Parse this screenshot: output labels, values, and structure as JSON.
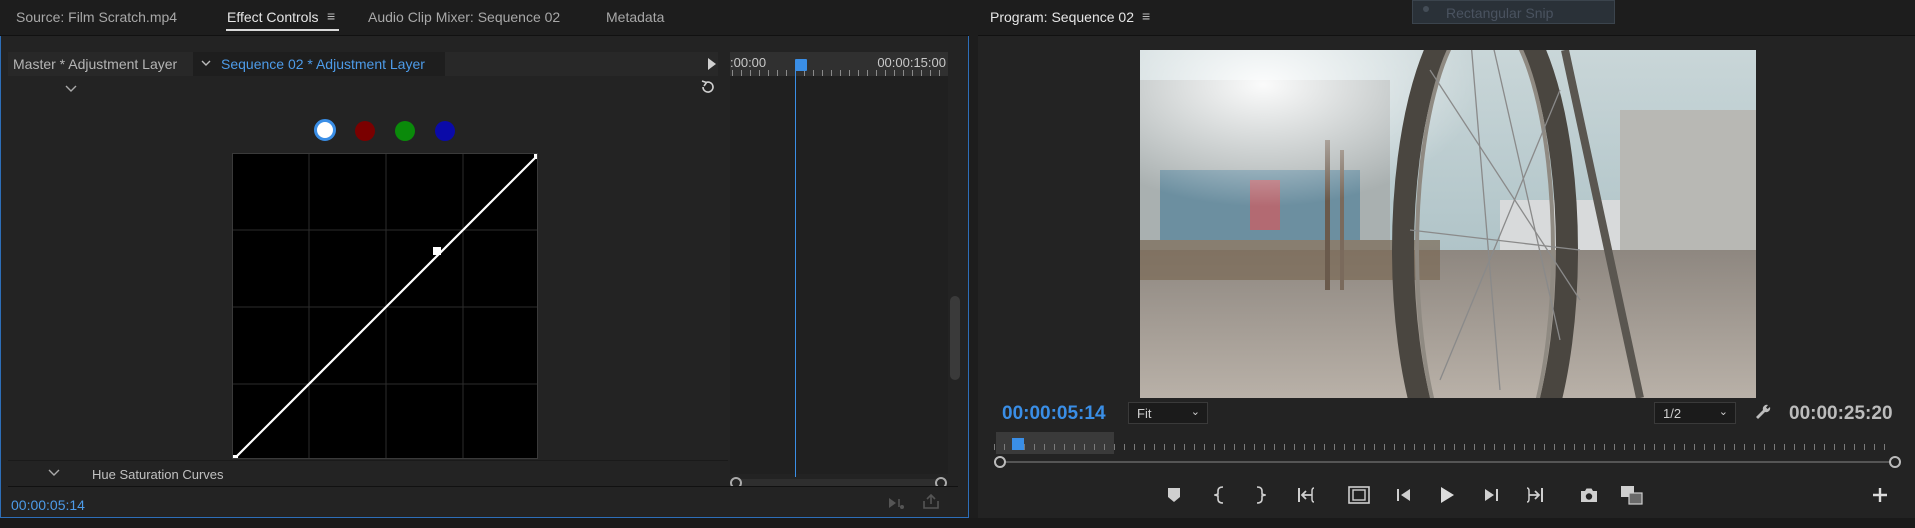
{
  "left_tabs": {
    "source": "Source: Film Scratch.mp4",
    "effect_controls": "Effect Controls",
    "audio_mixer": "Audio Clip Mixer: Sequence 02",
    "metadata": "Metadata"
  },
  "effect_controls": {
    "master_label": "Master * Adjustment Layer",
    "sequence_label": "Sequence 02 * Adjustment Layer",
    "section_label": "Hue Saturation Curves",
    "timecode": "00:00:05:14",
    "ruler_start": ":00:00",
    "ruler_end": "00:00:15:00"
  },
  "channels": [
    {
      "name": "master",
      "color": "#ffffff"
    },
    {
      "name": "red",
      "color": "#8b0000"
    },
    {
      "name": "green",
      "color": "#0a8a0a"
    },
    {
      "name": "blue",
      "color": "#0a0ab0"
    }
  ],
  "program": {
    "title": "Program: Sequence 02",
    "current_timecode": "00:00:05:14",
    "duration_timecode": "00:00:25:20",
    "fit_label": "Fit",
    "resolution_label": "1/2"
  },
  "snip_tooltip": "Rectangular Snip",
  "colors": {
    "accent": "#3a8ee6",
    "panel_border": "#2d6eb8"
  }
}
